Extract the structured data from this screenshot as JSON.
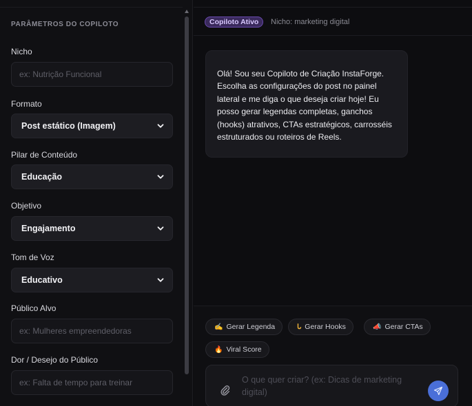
{
  "sidebar": {
    "title": "PARÂMETROS DO COPILOTO",
    "fields": {
      "nicho": {
        "label": "Nicho",
        "placeholder": "ex: Nutrição Funcional"
      },
      "formato": {
        "label": "Formato",
        "value": "Post estático (Imagem)"
      },
      "pilar": {
        "label": "Pilar de Conteúdo",
        "value": "Educação"
      },
      "objetivo": {
        "label": "Objetivo",
        "value": "Engajamento"
      },
      "tom": {
        "label": "Tom de Voz",
        "value": "Educativo"
      },
      "publico": {
        "label": "Público Alvo",
        "placeholder": "ex: Mulheres empreendedoras"
      },
      "dor": {
        "label": "Dor / Desejo do Público",
        "placeholder": "ex: Falta de tempo para treinar"
      }
    }
  },
  "header": {
    "badge": "Copiloto Ativo",
    "niche": "Nicho: marketing digital"
  },
  "chat": {
    "assistant_message": "Olá! Sou seu Copiloto de Criação InstaForge. Escolha as configurações do post no painel lateral e me diga o que deseja criar hoje! Eu posso gerar legendas completas, ganchos (hooks) atrativos, CTAs estratégicos, carrosséis estruturados ou roteiros de Reels."
  },
  "quick_actions": [
    {
      "icon": "✍",
      "label": "Gerar Legenda"
    },
    {
      "icon": "ᒐ",
      "label": "Gerar Hooks"
    },
    {
      "icon": "📣",
      "label": "Gerar CTAs"
    },
    {
      "icon": "🔥",
      "label": "Viral Score"
    }
  ],
  "composer": {
    "placeholder": "O que quer criar? (ex: Dicas de marketing digital)"
  },
  "colors": {
    "accent_purple": "#6a4ab0",
    "send_blue": "#4a6fd8",
    "background": "#0c0c0f"
  }
}
